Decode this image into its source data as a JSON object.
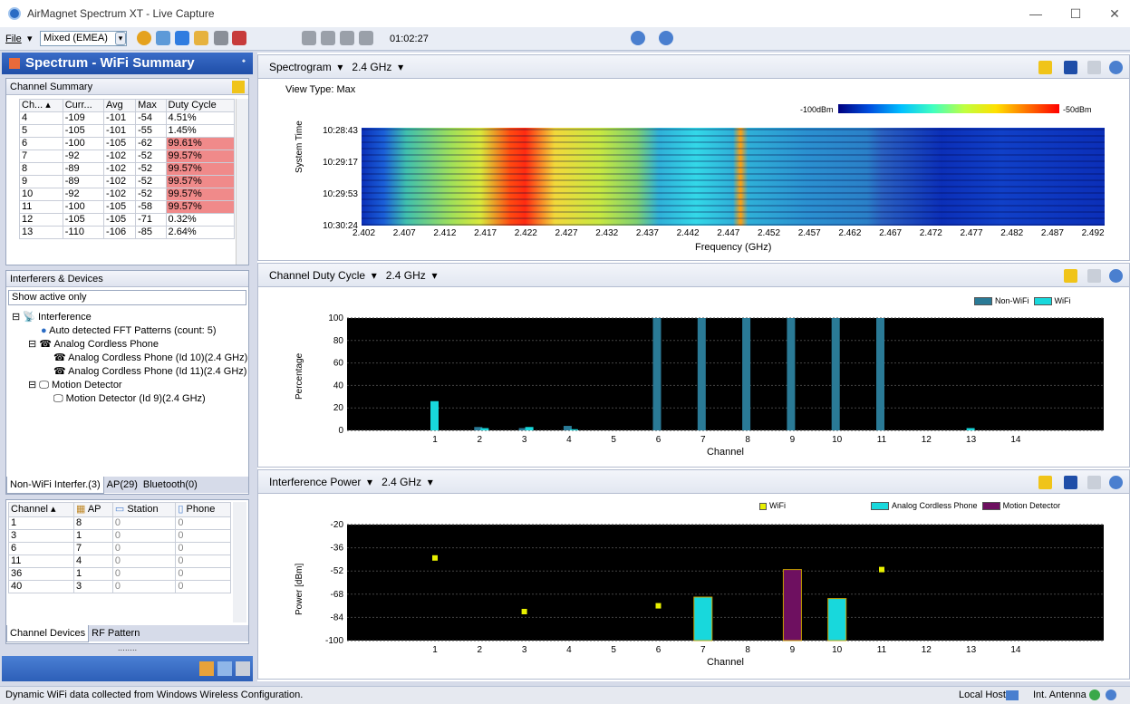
{
  "window": {
    "title": "AirMagnet Spectrum XT  -  Live Capture",
    "min": "—",
    "max": "☐",
    "close": "✕"
  },
  "toolbar": {
    "file": "File",
    "mode": "Mixed (EMEA)",
    "timer": "01:02:27"
  },
  "left": {
    "panel_title": "Spectrum - WiFi Summary",
    "channel_summary": {
      "title": "Channel Summary",
      "columns": [
        "Ch...",
        "Curr...",
        "Avg",
        "Max",
        "Duty Cycle"
      ],
      "rows": [
        {
          "ch": "4",
          "curr": "-109",
          "avg": "-101",
          "max": "-54",
          "dc": "4.51%",
          "hi": false
        },
        {
          "ch": "5",
          "curr": "-105",
          "avg": "-101",
          "max": "-55",
          "dc": "1.45%",
          "hi": false
        },
        {
          "ch": "6",
          "curr": "-100",
          "avg": "-105",
          "max": "-62",
          "dc": "99.61%",
          "hi": true
        },
        {
          "ch": "7",
          "curr": "-92",
          "avg": "-102",
          "max": "-52",
          "dc": "99.57%",
          "hi": true
        },
        {
          "ch": "8",
          "curr": "-89",
          "avg": "-102",
          "max": "-52",
          "dc": "99.57%",
          "hi": true
        },
        {
          "ch": "9",
          "curr": "-89",
          "avg": "-102",
          "max": "-52",
          "dc": "99.57%",
          "hi": true
        },
        {
          "ch": "10",
          "curr": "-92",
          "avg": "-102",
          "max": "-52",
          "dc": "99.57%",
          "hi": true
        },
        {
          "ch": "11",
          "curr": "-100",
          "avg": "-105",
          "max": "-58",
          "dc": "99.57%",
          "hi": true
        },
        {
          "ch": "12",
          "curr": "-105",
          "avg": "-105",
          "max": "-71",
          "dc": "0.32%",
          "hi": false
        },
        {
          "ch": "13",
          "curr": "-110",
          "avg": "-106",
          "max": "-85",
          "dc": "2.64%",
          "hi": false
        }
      ]
    },
    "interferers": {
      "title": "Interferers & Devices",
      "filter": "Show active only",
      "tree": {
        "root": "Interference",
        "auto": "Auto detected FFT Patterns (count: 5)",
        "cordless": "Analog Cordless Phone",
        "cordless1": "Analog Cordless Phone (Id 10)(2.4 GHz)",
        "cordless2": "Analog Cordless Phone (Id 11)(2.4 GHz)",
        "motion": "Motion Detector",
        "motion1": "Motion Detector (Id 9)(2.4 GHz)"
      },
      "tabs": [
        "Non-WiFi Interfer.(3)",
        "AP(29)",
        "Bluetooth(0)"
      ]
    },
    "devices": {
      "columns": [
        "Channel",
        "AP",
        "Station",
        "Phone"
      ],
      "rows": [
        [
          "1",
          "8",
          "0",
          "0"
        ],
        [
          "3",
          "1",
          "0",
          "0"
        ],
        [
          "6",
          "7",
          "0",
          "0"
        ],
        [
          "11",
          "4",
          "0",
          "0"
        ],
        [
          "36",
          "1",
          "0",
          "0"
        ],
        [
          "40",
          "3",
          "0",
          "0"
        ]
      ],
      "tabs": [
        "Channel Devices",
        "RF Pattern"
      ]
    }
  },
  "spectrogram": {
    "title": "Spectrogram",
    "band": "2.4 GHz",
    "view_type": "View Type: Max",
    "legend_low": "-100dBm",
    "legend_high": "-50dBm",
    "ylabel": "System Time",
    "times": [
      "10:28:43",
      "10:29:17",
      "10:29:53",
      "10:30:24"
    ],
    "xlabel": "Frequency (GHz)",
    "freqs": [
      "2.402",
      "2.407",
      "2.412",
      "2.417",
      "2.422",
      "2.427",
      "2.432",
      "2.437",
      "2.442",
      "2.447",
      "2.452",
      "2.457",
      "2.462",
      "2.467",
      "2.472",
      "2.477",
      "2.482",
      "2.487",
      "2.492"
    ]
  },
  "chart_data": [
    {
      "type": "bar",
      "title": "Channel Duty Cycle",
      "band": "2.4 GHz",
      "xlabel": "Channel",
      "ylabel": "Percentage",
      "ylim": [
        0,
        100
      ],
      "yticks": [
        "0",
        "20",
        "40",
        "60",
        "80",
        "100"
      ],
      "categories": [
        "1",
        "2",
        "3",
        "4",
        "5",
        "6",
        "7",
        "8",
        "9",
        "10",
        "11",
        "12",
        "13",
        "14"
      ],
      "series": [
        {
          "name": "Non-WiFi",
          "color": "#2a7a96",
          "values": [
            0,
            3,
            2,
            4,
            0,
            100,
            100,
            100,
            100,
            100,
            100,
            0,
            0,
            0
          ]
        },
        {
          "name": "WiFi",
          "color": "#18d8dc",
          "values": [
            26,
            2,
            3,
            1,
            0,
            0,
            0,
            0,
            0,
            0,
            0,
            0,
            2,
            0
          ]
        }
      ]
    },
    {
      "type": "bar",
      "title": "Interference Power",
      "band": "2.4 GHz",
      "xlabel": "Channel",
      "ylabel": "Power [dBm]",
      "ylim": [
        -100,
        -20
      ],
      "yticks": [
        "-20",
        "-36",
        "-52",
        "-68",
        "-84",
        "-100"
      ],
      "categories": [
        "1",
        "2",
        "3",
        "4",
        "5",
        "6",
        "7",
        "8",
        "9",
        "10",
        "11",
        "12",
        "13",
        "14"
      ],
      "wifi_points": {
        "name": "WiFi",
        "color": "#e8f000",
        "x": [
          1,
          3,
          6,
          11
        ],
        "y": [
          -43,
          -80,
          -76,
          -51
        ]
      },
      "bars": [
        {
          "name": "Analog Cordless Phone",
          "color": "#18d8dc",
          "x": [
            7,
            10
          ],
          "y": [
            -70,
            -71
          ]
        },
        {
          "name": "Motion Detector",
          "color": "#6e1060",
          "x": [
            9
          ],
          "y": [
            -51
          ]
        }
      ]
    }
  ],
  "status": {
    "text": "Dynamic WiFi data collected from Windows Wireless Configuration.",
    "host": "Local Host",
    "antenna": "Int. Antenna"
  }
}
